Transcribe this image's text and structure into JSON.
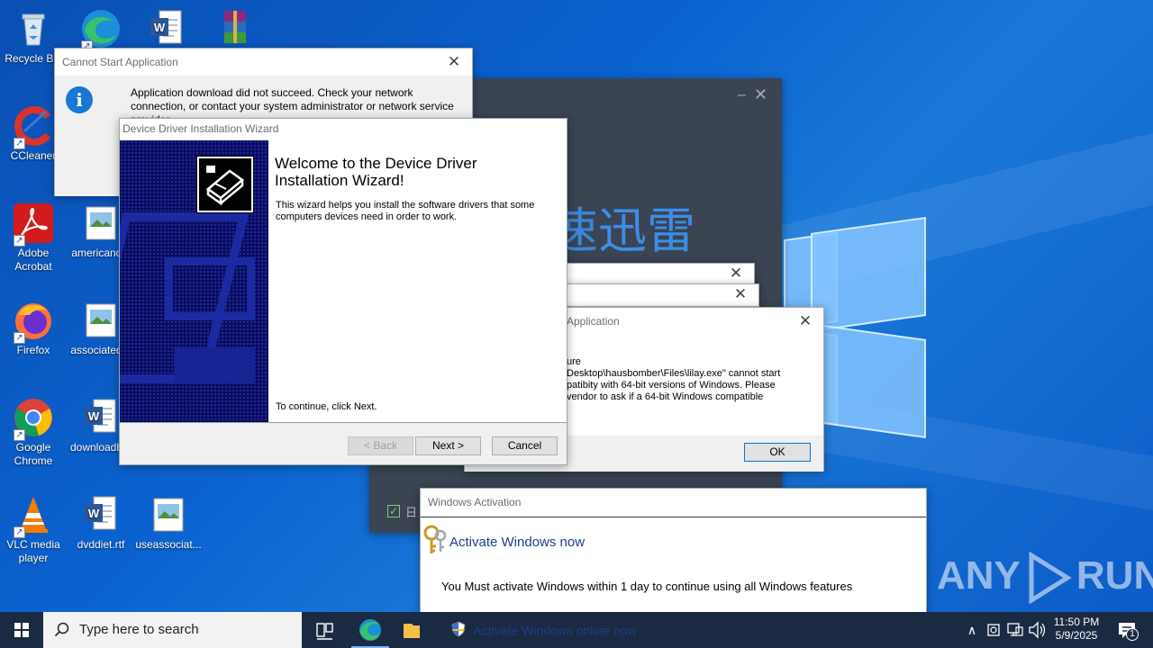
{
  "desktop": {
    "icons": [
      {
        "label": "Recycle Bin",
        "icon": "recycle-bin-icon"
      },
      {
        "label": "Microsoft Edge",
        "icon": "edge-icon"
      },
      {
        "label": "",
        "icon": "word-document-icon"
      },
      {
        "label": "",
        "icon": "winrar-archive-icon"
      },
      {
        "label": "CCleaner",
        "icon": "ccleaner-icon"
      },
      {
        "label": "Adobe Acrobat",
        "icon": "adobe-acrobat-icon"
      },
      {
        "label": "americanc...",
        "icon": "image-file-icon"
      },
      {
        "label": "Firefox",
        "icon": "firefox-icon"
      },
      {
        "label": "associated...",
        "icon": "image-file-icon"
      },
      {
        "label": "Google Chrome",
        "icon": "chrome-icon"
      },
      {
        "label": "downloadb...",
        "icon": "word-document-icon"
      },
      {
        "label": "VLC media player",
        "icon": "vlc-icon"
      },
      {
        "label": "dvddiet.rtf",
        "icon": "word-document-icon"
      },
      {
        "label": "useassociat...",
        "icon": "image-file-icon"
      }
    ]
  },
  "cannot_start": {
    "title": "Cannot Start Application",
    "message_line1": "Application download did not succeed. Check your network",
    "message_line2": "connection, or contact your system administrator or network service",
    "message_line3": "provider."
  },
  "xunlei": {
    "brand_text": "迅雷",
    "partial_char": "速",
    "checkbox_text": "日"
  },
  "compat": {
    "title": "Application",
    "line1": "ure",
    "line2": "Desktop\\hausbomber\\Files\\lilay.exe\" cannot start",
    "line3": "patibity with 64-bit versions of Windows. Please",
    "line4": "vendor to ask if a 64-bit Windows compatible",
    "ok_label": "OK"
  },
  "wizard": {
    "title": "Device Driver Installation Wizard",
    "heading_line1": "Welcome to the Device Driver",
    "heading_line2": "Installation Wizard!",
    "body_line1": "This wizard helps you install the software drivers that some",
    "body_line2": "computers devices need in order to work.",
    "continue_text": "To continue, click Next.",
    "back_label": "< Back",
    "next_label": "Next >",
    "cancel_label": "Cancel"
  },
  "activation": {
    "title": "Windows Activation",
    "heading": "Activate Windows now",
    "message": "You Must activate Windows within 1 day to continue using all Windows features",
    "online_link": "Activate Windows online now"
  },
  "watermark": {
    "text_left": "ANY",
    "text_right": "RUN"
  },
  "taskbar": {
    "search_placeholder": "Type here to search",
    "time": "11:50 PM",
    "date": "5/9/2025",
    "notification_count": "1"
  }
}
